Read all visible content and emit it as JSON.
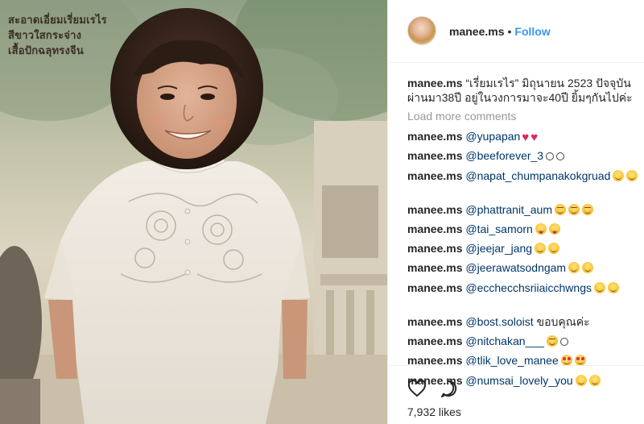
{
  "post": {
    "print_caption": [
      "สะอาดเอี่ยมเรี่ยมเรไร",
      "สีขาวใสกระจ่าง",
      "เสื้อปักฉลุทรงจีน"
    ],
    "author": "manee.ms",
    "separator": "•",
    "follow_label": "Follow",
    "caption_user": "manee.ms",
    "caption_text": "“เรี่ยมเรไร” มิถุนายน 2523 ปัจจุบันผ่านมา38ปี อยู่ในวงการมาจะ40ปี ยิ้มๆกันไปค่ะ",
    "load_more_label": "Load more comments",
    "likes_text": "7,932 likes",
    "accent_color": "#3897f0",
    "mention_color": "#003569"
  },
  "comments": [
    {
      "user": "manee.ms",
      "mention": "@yupapan",
      "text": "",
      "emoji": [
        "red-heart",
        "red-heart"
      ]
    },
    {
      "user": "manee.ms",
      "mention": "@beeforever_3",
      "text": "",
      "emoji": [
        "small-smile",
        "small-smile"
      ]
    },
    {
      "user": "manee.ms",
      "mention": "@napat_chumpanakokgruad",
      "text": "",
      "emoji": [
        "smiling-face",
        "smiling-face"
      ]
    },
    {
      "user": "manee.ms",
      "mention": "@phattranit_aum",
      "text": "",
      "emoji": [
        "squinting-face",
        "squinting-face",
        "squinting-face"
      ]
    },
    {
      "user": "manee.ms",
      "mention": "@tai_samorn",
      "text": "",
      "emoji": [
        "tongue-face",
        "tongue-face"
      ]
    },
    {
      "user": "manee.ms",
      "mention": "@jeejar_jang",
      "text": "",
      "emoji": [
        "smiling-face",
        "smiling-face"
      ]
    },
    {
      "user": "manee.ms",
      "mention": "@jeerawatsodngam",
      "text": "",
      "emoji": [
        "smiling-face",
        "smiling-face"
      ]
    },
    {
      "user": "manee.ms",
      "mention": "@ecchecchsriiaicchwngs",
      "text": "",
      "emoji": [
        "smiling-face",
        "smiling-face"
      ]
    },
    {
      "user": "manee.ms",
      "mention": "@bost.soloist",
      "text": "ขอบคุณค่ะ",
      "emoji": []
    },
    {
      "user": "manee.ms",
      "mention": "@nitchakan___",
      "text": "",
      "emoji": [
        "squinting-face",
        "small-smile"
      ]
    },
    {
      "user": "manee.ms",
      "mention": "@tlik_love_manee",
      "text": "",
      "emoji": [
        "heart-eyes-face",
        "heart-eyes-face"
      ]
    },
    {
      "user": "manee.ms",
      "mention": "@numsai_lovely_you",
      "text": "",
      "emoji": [
        "smiling-face",
        "smiling-face"
      ]
    }
  ],
  "icons": {
    "like": "heart-outline-icon",
    "comment": "speech-bubble-icon"
  }
}
